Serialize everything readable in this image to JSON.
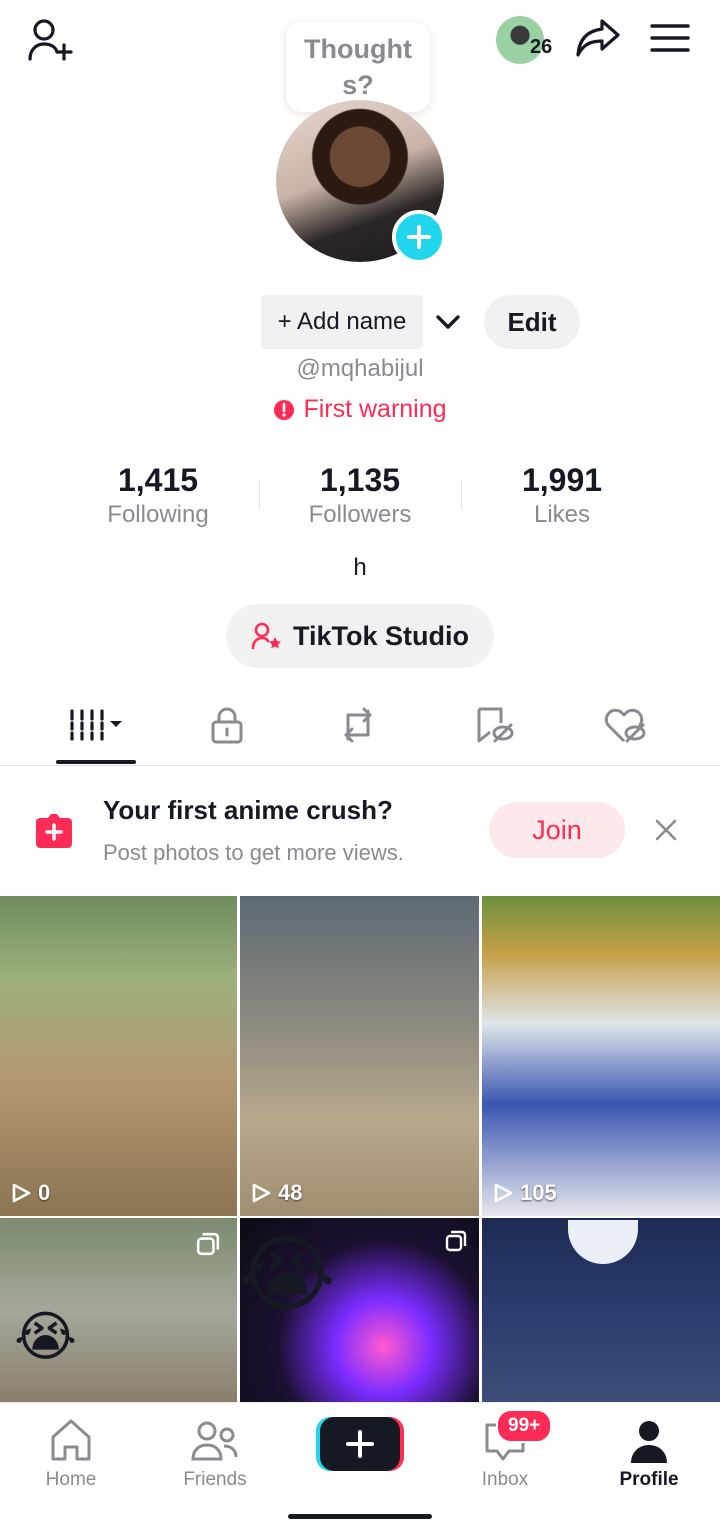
{
  "header": {
    "add_friend_icon": "person-plus-icon",
    "thought_bubble": "Thought\ns?",
    "friend_count": "26",
    "share_icon": "share-arrow-icon",
    "menu_icon": "hamburger-menu-icon"
  },
  "profile": {
    "add_name": "+ Add name",
    "edit": "Edit",
    "username": "@mqhabijul",
    "warning": "First warning",
    "bio": "h",
    "studio": "TikTok Studio"
  },
  "stats": [
    {
      "value": "1,415",
      "label": "Following"
    },
    {
      "value": "1,135",
      "label": "Followers"
    },
    {
      "value": "1,991",
      "label": "Likes"
    }
  ],
  "tabs": [
    {
      "name": "videos-grid-icon",
      "active": true
    },
    {
      "name": "lock-icon",
      "active": false
    },
    {
      "name": "repost-icon",
      "active": false
    },
    {
      "name": "bookmark-hidden-icon",
      "active": false
    },
    {
      "name": "liked-hidden-icon",
      "active": false
    }
  ],
  "promo": {
    "title": "Your first anime crush?",
    "subtitle": "Post photos to get more views.",
    "join": "Join"
  },
  "videos": [
    {
      "views": "0"
    },
    {
      "views": "48"
    },
    {
      "views": "105"
    },
    {
      "views": ""
    },
    {
      "views": ""
    },
    {
      "views": ""
    }
  ],
  "nav": {
    "home": "Home",
    "friends": "Friends",
    "inbox": "Inbox",
    "inbox_badge": "99+",
    "profile": "Profile"
  },
  "colors": {
    "accent": "#fe2c55",
    "cyan": "#20d5ec",
    "text": "#161823",
    "muted": "#8a8b91"
  }
}
